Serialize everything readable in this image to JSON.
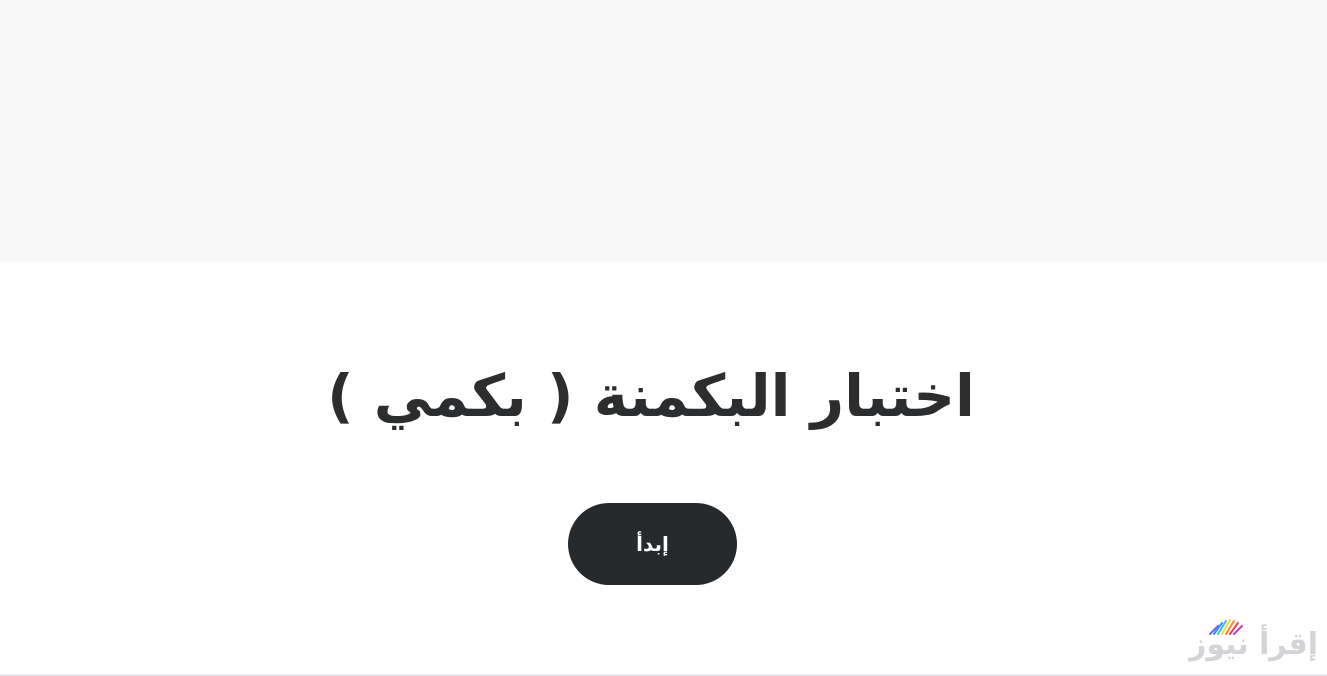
{
  "hero": {
    "title": "اختبار البكمنة ( بكمي )",
    "start_button_label": "إبدأ"
  },
  "watermark": {
    "text": "إقرأ نيوز",
    "icon": "book-rays-icon"
  },
  "colors": {
    "banner_background": "#f9f9f9",
    "page_background": "#ffffff",
    "title_text": "#2b2d2f",
    "button_background": "#272a2d",
    "button_text": "#ffffff",
    "watermark_text": "#d2d4d7"
  }
}
